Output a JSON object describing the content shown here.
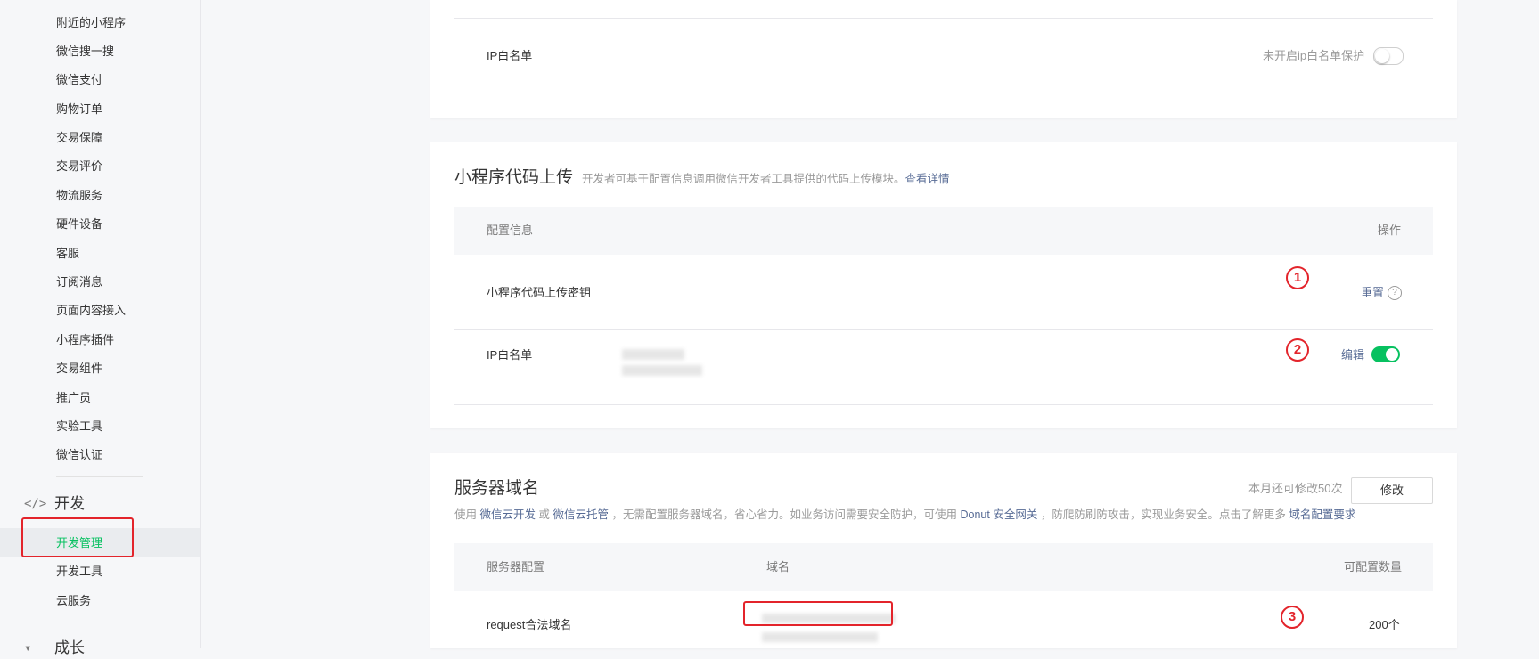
{
  "sidebar": {
    "items": [
      "附近的小程序",
      "微信搜一搜",
      "微信支付",
      "购物订单",
      "交易保障",
      "交易评价",
      "物流服务",
      "硬件设备",
      "客服",
      "订阅消息",
      "页面内容接入",
      "小程序插件",
      "交易组件",
      "推广员",
      "实验工具",
      "微信认证"
    ],
    "dev_section": {
      "icon": "</>",
      "title": "开发"
    },
    "dev_items": [
      "开发管理",
      "开发工具",
      "云服务"
    ],
    "next_section": "成长"
  },
  "ip_card": {
    "label": "IP白名单",
    "toggle_label": "未开启ip白名单保护",
    "toggle_on": false
  },
  "upload_card": {
    "title": "小程序代码上传",
    "desc": "开发者可基于配置信息调用微信开发者工具提供的代码上传模块。",
    "desc_link": "查看详情",
    "col_config": "配置信息",
    "col_action": "操作",
    "row1_label": "小程序代码上传密钥",
    "row1_action": "重置",
    "row2_label": "IP白名单",
    "row2_action": "编辑",
    "row2_toggle_on": true,
    "marker1": "1",
    "marker2": "2"
  },
  "server_card": {
    "title": "服务器域名",
    "quota": "本月还可修改50次",
    "modify": "修改",
    "desc_1": "使用",
    "link_cloud_dev": "微信云开发",
    "desc_or": "或",
    "link_cloud_host": "微信云托管",
    "desc_2": "，无需配置服务器域名，省心省力。如业务访问需要安全防护，可使用",
    "link_donut": "Donut 安全网关",
    "desc_3": "，防爬防刷防攻击，实现业务安全。点击了解更多",
    "link_req": "域名配置要求",
    "col_server": "服务器配置",
    "col_domain": "域名",
    "col_count": "可配置数量",
    "row1_label": "request合法域名",
    "row1_count": "200个",
    "marker3": "3"
  },
  "colors": {
    "accent": "#07c160",
    "link": "#576b95",
    "annotation": "#e3242b"
  }
}
